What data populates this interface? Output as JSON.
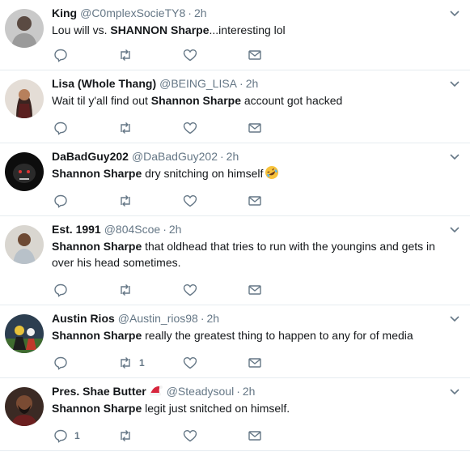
{
  "tweets": [
    {
      "name": "King",
      "handle": "@C0mplexSocieTY8",
      "separator": "·",
      "time": "2h",
      "mention": "",
      "text_before": "Lou will vs. ",
      "bold": "SHANNON Sharpe",
      "text_after": "...interesting lol",
      "reply_count": "",
      "retweet_count": "",
      "like_count": ""
    },
    {
      "name": "Lisa (Whole Thang)",
      "handle": "@BEING_LISA",
      "separator": "·",
      "time": "2h",
      "mention": "",
      "text_before": "Wait til y'all find out ",
      "bold": "Shannon Sharpe",
      "text_after": " account got hacked",
      "reply_count": "",
      "retweet_count": "",
      "like_count": ""
    },
    {
      "name": "DaBadGuy202",
      "handle": "@DaBadGuy202",
      "separator": "·",
      "time": "2h",
      "mention": "",
      "text_before": "",
      "bold": "Shannon Sharpe",
      "text_after": " dry snitching on himself",
      "emoji": "rolling-on-floor-laughing",
      "reply_count": "",
      "retweet_count": "",
      "like_count": ""
    },
    {
      "name": "Est. 1991",
      "handle": "@804Scoe",
      "separator": "·",
      "time": "2h",
      "mention": "",
      "text_before": "",
      "bold": "Shannon Sharpe",
      "text_after": " that oldhead that tries to run with the youngins and gets in over his head sometimes.",
      "reply_count": "",
      "retweet_count": "",
      "like_count": ""
    },
    {
      "name": "Austin Rios",
      "handle": "@Austin_rios98",
      "separator": "·",
      "time": "2h",
      "mention": "",
      "text_before": "",
      "bold": "Shannon Sharpe",
      "text_after": " really the greatest thing to happen to any for of media",
      "reply_count": "",
      "retweet_count": "1",
      "like_count": ""
    },
    {
      "name": "Pres. Shae Butter",
      "name_emoji": "santa-hat",
      "handle": "@Steadysoul",
      "separator": "·",
      "time": "2h",
      "mention": "",
      "text_before": "",
      "bold": "Shannon Sharpe",
      "text_after": " legit just snitched on himself.",
      "reply_count": "1",
      "retweet_count": "",
      "like_count": ""
    }
  ],
  "icons": {
    "reply": "reply-icon",
    "retweet": "retweet-icon",
    "like": "heart-icon",
    "dm": "envelope-icon",
    "more": "chevron-down-icon"
  },
  "colors": {
    "text": "#14171a",
    "secondary": "#657786",
    "border": "#e6ecf0"
  }
}
